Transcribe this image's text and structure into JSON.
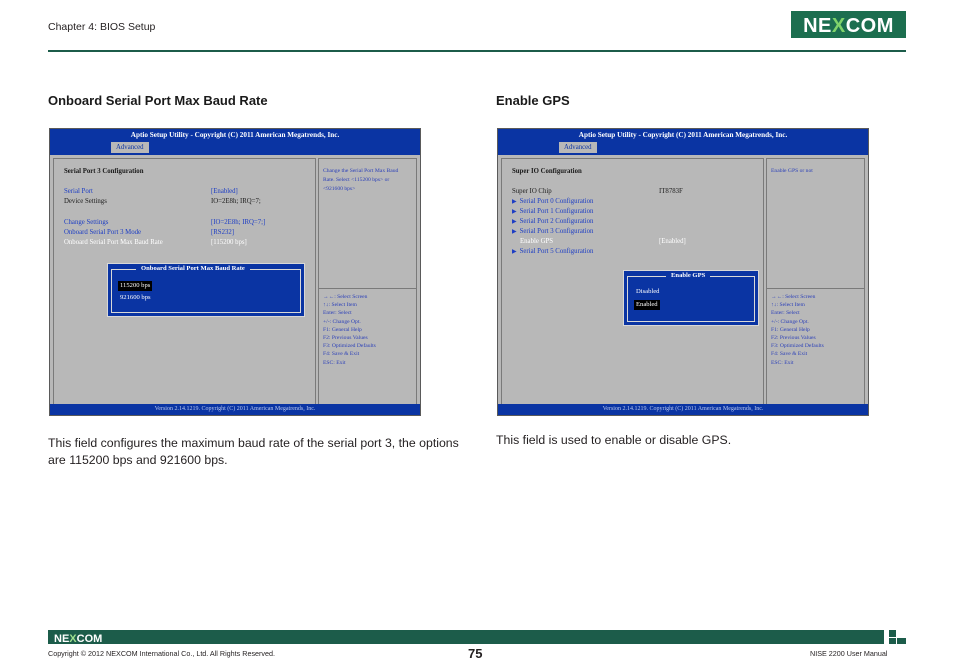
{
  "header": {
    "chapter": "Chapter 4: BIOS Setup",
    "logo": "NEXCOM"
  },
  "sections": [
    {
      "title": "Onboard Serial Port Max Baud Rate",
      "description": "This field configures the maximum baud rate of the serial port 3, the options are 115200 bps and 921600 bps.",
      "bios": {
        "title": "Aptio Setup Utility - Copyright (C) 2011 American Megatrends, Inc.",
        "tab": "Advanced",
        "heading": "Serial Port 3 Configuration",
        "rows": [
          {
            "label": "Serial Port",
            "value": "[Enabled]"
          },
          {
            "label": "Device Settings",
            "value": "IO=2E8h; IRQ=7;"
          },
          {
            "label": "Change Settings",
            "value": "[IO=2E8h; IRQ=7;]"
          },
          {
            "label": "Onboard Serial Port 3 Mode",
            "value": "[RS232]"
          },
          {
            "label": "Onboard Serial Port Max Baud Rate",
            "value": "[115200 bps]"
          }
        ],
        "help": [
          "Change the Serial Port Max Baud",
          "Rate. Select <115200 bps> or",
          "<921600 bps>"
        ],
        "popup": {
          "title": "Onboard Serial Port Max Baud Rate",
          "options": [
            "115200 bps",
            "921600 bps"
          ],
          "selected": "115200 bps"
        },
        "keys": [
          "→←: Select Screen",
          "↑↓: Select Item",
          "Enter: Select",
          "+/-: Change Opt.",
          "F1: General Help",
          "F2: Previous Values",
          "F3: Optimized Defaults",
          "F4: Save & Exit",
          "ESC: Exit"
        ],
        "footer": "Version 2.14.1219. Copyright (C) 2011 American Megatrends, Inc."
      }
    },
    {
      "title": "Enable GPS",
      "description": "This field is used to enable or disable GPS.",
      "bios": {
        "title": "Aptio Setup Utility - Copyright (C) 2011 American Megatrends, Inc.",
        "tab": "Advanced",
        "heading": "Super IO Configuration",
        "chip": {
          "label": "Super IO Chip",
          "value": "IT8783F"
        },
        "rows": [
          {
            "label": "Serial Port 0 Configuration",
            "value": ""
          },
          {
            "label": "Serial Port 1 Configuration",
            "value": ""
          },
          {
            "label": "Serial Port 2 Configuration",
            "value": ""
          },
          {
            "label": "Serial Port 3 Configuration",
            "value": ""
          },
          {
            "label": "Enable GPS",
            "value": "[Enabled]"
          },
          {
            "label": "Serial Port 5 Configuration",
            "value": ""
          }
        ],
        "help": [
          "Enable GPS or not"
        ],
        "popup": {
          "title": "Enable GPS",
          "options": [
            "Disabled",
            "Enabled"
          ],
          "selected": "Enabled"
        },
        "keys": [
          "→←: Select Screen",
          "↑↓: Select Item",
          "Enter: Select",
          "+/-: Change Opt.",
          "F1: General Help",
          "F2: Previous Values",
          "F3: Optimized Defaults",
          "F4: Save & Exit",
          "ESC: Exit"
        ],
        "footer": "Version 2.14.1219. Copyright (C) 2011 American Megatrends, Inc."
      }
    }
  ],
  "footer": {
    "copyright": "Copyright © 2012 NEXCOM International Co., Ltd. All Rights Reserved.",
    "page": "75",
    "manual": "NISE 2200 User Manual"
  },
  "colors": {
    "brand": "#1c5c4a",
    "logo_blue": "#0060a9",
    "bios_blue": "#0a34a3",
    "bios_gray": "#b8b8b8"
  }
}
